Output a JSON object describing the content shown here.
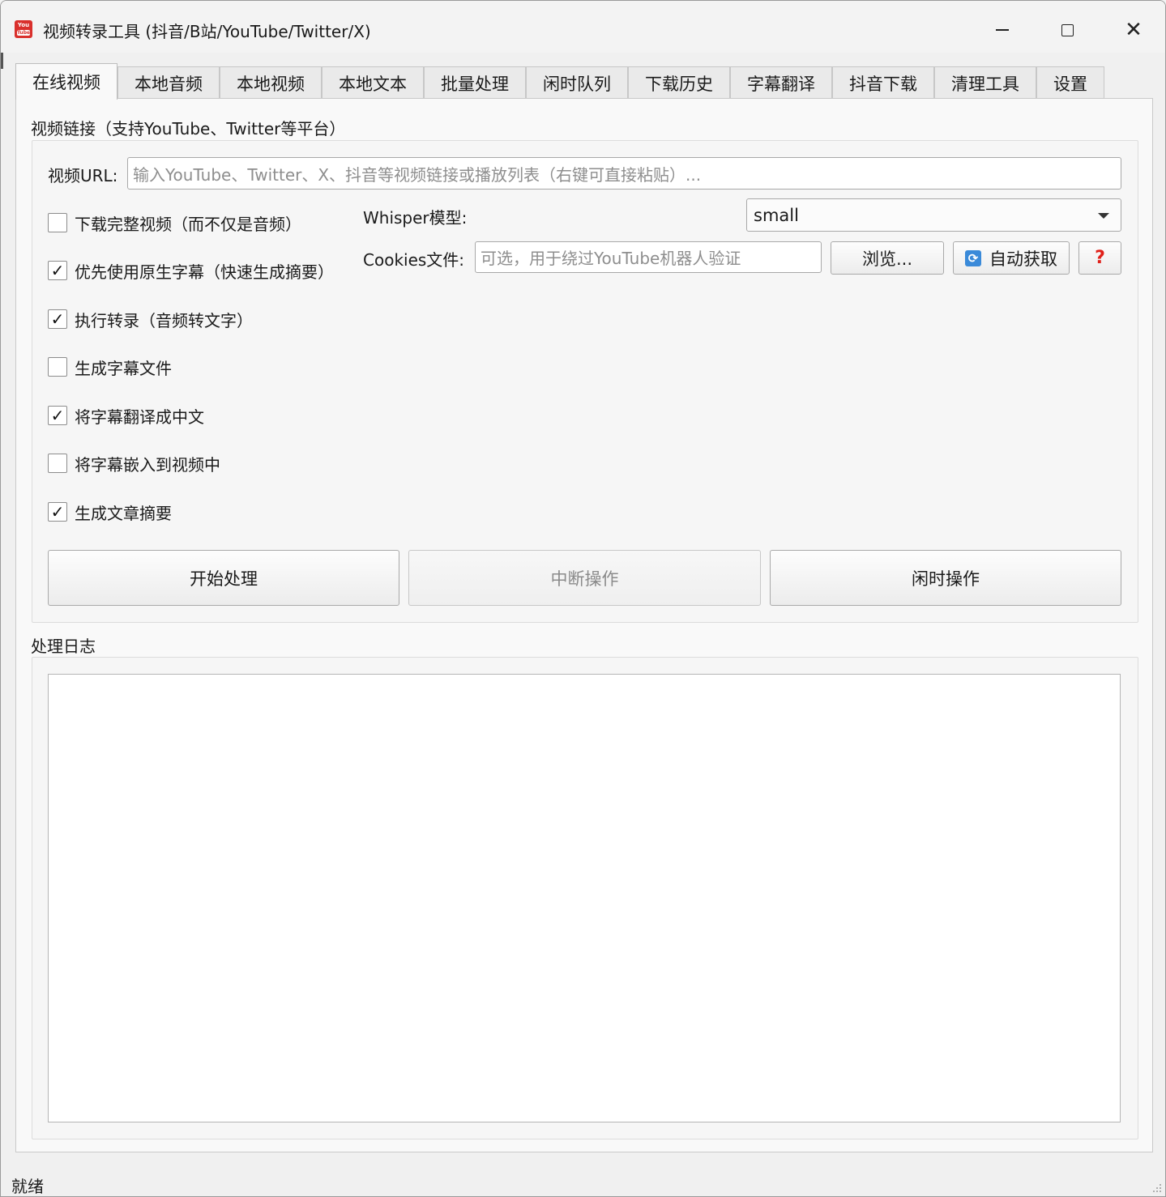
{
  "window": {
    "title": "视频转录工具 (抖音/B站/YouTube/Twitter/X)",
    "app_icon_top": "You",
    "app_icon_bottom": "Tube"
  },
  "tabs": [
    {
      "label": "在线视频",
      "active": true
    },
    {
      "label": "本地音频"
    },
    {
      "label": "本地视频"
    },
    {
      "label": "本地文本"
    },
    {
      "label": "批量处理"
    },
    {
      "label": "闲时队列"
    },
    {
      "label": "下载历史"
    },
    {
      "label": "字幕翻译"
    },
    {
      "label": "抖音下载"
    },
    {
      "label": "清理工具"
    },
    {
      "label": "设置"
    }
  ],
  "link_group": {
    "title": "视频链接（支持YouTube、Twitter等平台）",
    "url_label": "视频URL:",
    "url_placeholder": "输入YouTube、Twitter、X、抖音等视频链接或播放列表（右键可直接粘贴）...",
    "whisper_label": "Whisper模型:",
    "whisper_value": "small",
    "cookies_label": "Cookies文件:",
    "cookies_placeholder": "可选，用于绕过YouTube机器人验证",
    "browse_label": "浏览...",
    "auto_fetch_label": "自动获取",
    "help_label": "?",
    "options": [
      {
        "label": "下载完整视频（而不仅是音频）",
        "checked": false
      },
      {
        "label": "优先使用原生字幕（快速生成摘要）",
        "checked": true
      },
      {
        "label": "执行转录（音频转文字）",
        "checked": true
      },
      {
        "label": "生成字幕文件",
        "checked": false
      },
      {
        "label": "将字幕翻译成中文",
        "checked": true
      },
      {
        "label": "将字幕嵌入到视频中",
        "checked": false
      },
      {
        "label": "生成文章摘要",
        "checked": true
      }
    ],
    "start_label": "开始处理",
    "abort_label": "中断操作",
    "idle_label": "闲时操作"
  },
  "log_group": {
    "title": "处理日志",
    "content": ""
  },
  "status": {
    "text": "就绪"
  },
  "icons": {
    "check_mark": "✓",
    "refresh": "⟳",
    "close": "✕"
  }
}
